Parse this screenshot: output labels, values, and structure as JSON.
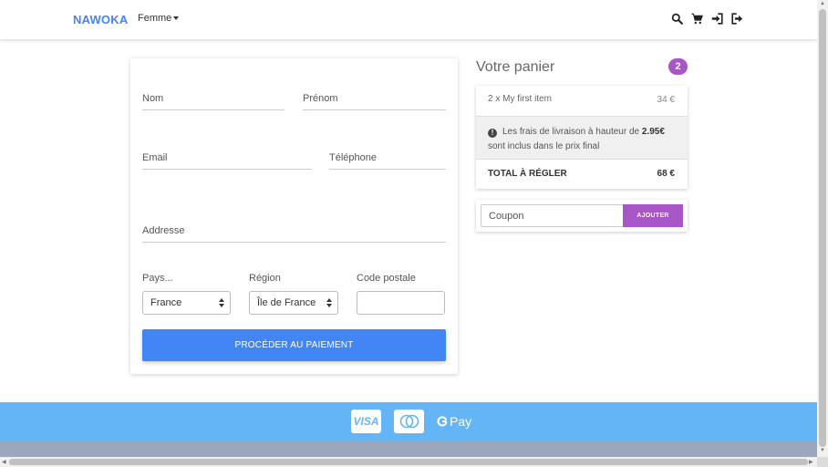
{
  "navbar": {
    "brand": "NAWOKA",
    "dropdown": "Femme",
    "icons": [
      "search-icon",
      "cart-icon",
      "sign-in-icon",
      "sign-out-icon"
    ]
  },
  "form": {
    "nom_label": "Nom",
    "prenom_label": "Prénom",
    "email_label": "Email",
    "telephone_label": "Téléphone",
    "address_label": "Addresse",
    "pays_label": "Pays...",
    "pays_value": "France",
    "region_label": "Région",
    "region_value": "Île de France",
    "postal_label": "Code postale",
    "submit_label": "PROCÉDER AU PAIEMENT"
  },
  "cart": {
    "title": "Votre panier",
    "count": "2",
    "item_name": "2 x My first item",
    "item_price": "34 €",
    "shipping_text_before": "Les frais de livraison à hauteur de",
    "shipping_amount": "2.95€",
    "shipping_text_after": "sont inclus dans le prix final",
    "total_label": "TOTAL À RÉGLER",
    "total_value": "68 €",
    "coupon_placeholder": "Coupon",
    "coupon_button": "AJOUTER"
  },
  "footer": {
    "visa": "VISA",
    "gpay": "Pay"
  },
  "colors": {
    "primary": "#4285f4",
    "accent": "#a855c8",
    "footer": "#64b5f6"
  }
}
